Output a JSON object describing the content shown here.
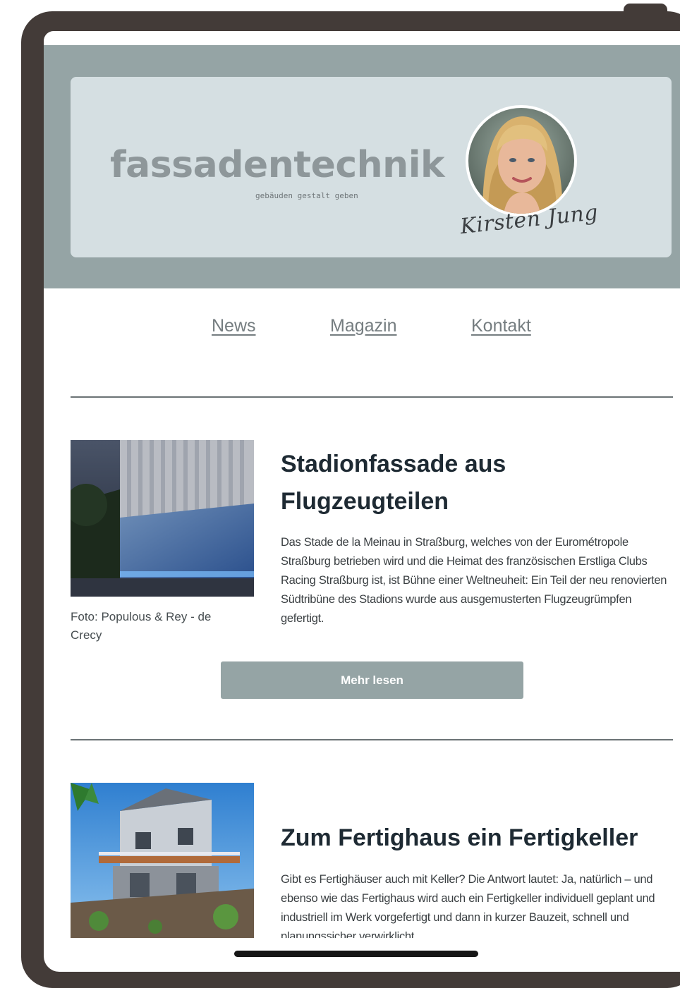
{
  "header": {
    "logo_word": "fassadentechnik",
    "logo_tagline": "gebäuden gestalt geben",
    "signature": "Kirsten Jung"
  },
  "nav": {
    "items": [
      "News",
      "Magazin",
      "Kontakt"
    ]
  },
  "articles": [
    {
      "title_line1": "Stadionfassade aus",
      "title_line2": "Flugzeugteilen",
      "body": "Das Stade de la Meinau in Straßburg, welches von der Eurométropole Straßburg betrieben wird und die Heimat des französischen Erstliga Clubs Racing Straßburg ist, ist Bühne einer Weltneuheit: Ein Teil der neu renovierten Südtribüne des Stadions wurde aus ausgemusterten Flugzeugrümpfen gefertigt.",
      "caption": "Foto: Populous & Rey - de Crecy",
      "button": "Mehr lesen"
    },
    {
      "title": "Zum Fertighaus ein Fertigkeller",
      "body": "Gibt es Fertighäuser auch mit Keller? Die Antwort lautet: Ja, natürlich – und ebenso wie das Fertighaus wird auch ein Fertigkeller individuell geplant und industriell im Werk vorgefertigt und dann in kurzer Bauzeit, schnell und planungssicher verwirklicht."
    }
  ],
  "colors": {
    "frame": "#433b38",
    "header_band": "#95a4a5",
    "header_card": "#d5dfe2",
    "button": "#95a4a5",
    "title": "#1e2a33"
  }
}
